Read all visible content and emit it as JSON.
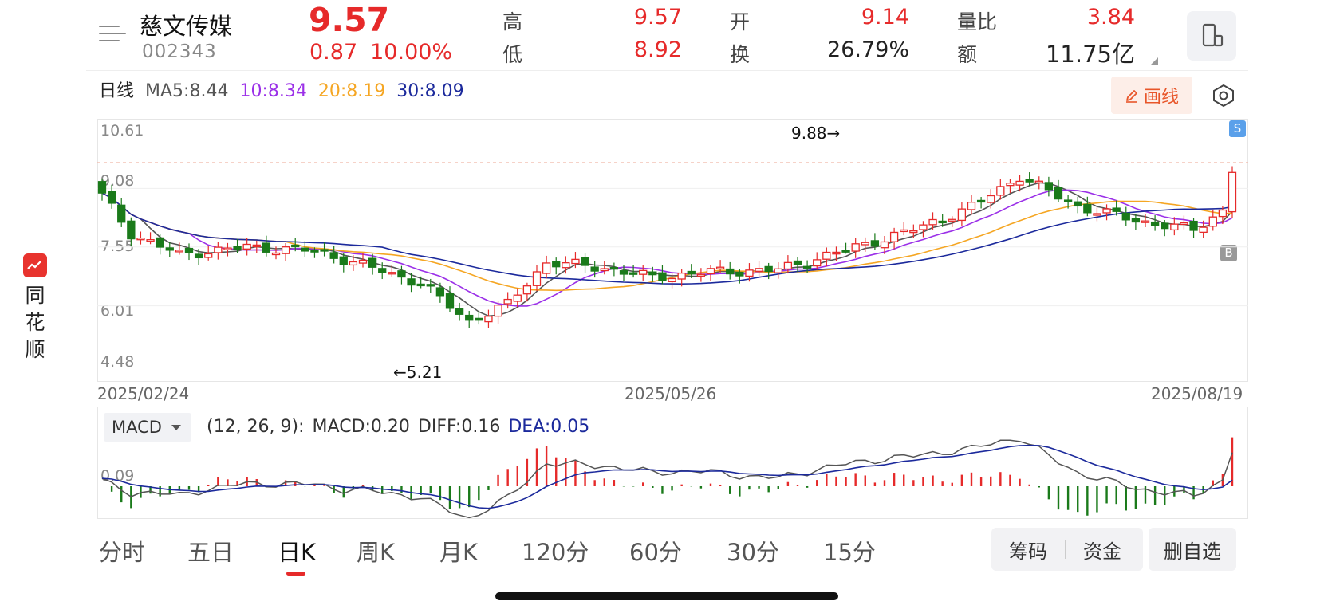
{
  "header": {
    "stock_name": "慈文传媒",
    "stock_code": "002343",
    "price": "9.57",
    "change": "0.87",
    "change_pct": "10.00%",
    "quotes": {
      "high_label": "高",
      "high": "9.57",
      "low_label": "低",
      "low": "8.92",
      "open_label": "开",
      "open": "9.14",
      "turnover_label": "换",
      "turnover": "26.79%",
      "vol_ratio_label": "量比",
      "vol_ratio": "3.84",
      "amount_label": "额",
      "amount": "11.75亿"
    }
  },
  "ma_legend": {
    "period": "日线",
    "ma5": "MA5:8.44",
    "ma10": "10:8.34",
    "ma20": "20:8.19",
    "ma30": "30:8.09"
  },
  "toolbar": {
    "draw_label": "画线"
  },
  "side_logo": {
    "text": "同花顺"
  },
  "kchart": {
    "y_ticks": [
      "10.61",
      "9.08",
      "7.55",
      "6.01",
      "4.48"
    ],
    "dates": [
      "2025/02/24",
      "2025/05/26",
      "2025/08/19"
    ],
    "high_anno": "9.88→",
    "low_anno": "←5.21",
    "sell_mark": "S",
    "buy_mark": "B"
  },
  "macd": {
    "selector": "MACD",
    "params": "(12, 26, 9):",
    "macd": "MACD:0.20",
    "diff": "DIFF:0.16",
    "dea": "DEA:0.05",
    "zero_label": "0.09"
  },
  "tabs": [
    "分时",
    "五日",
    "日K",
    "周K",
    "月K",
    "120分",
    "60分",
    "30分",
    "15分"
  ],
  "active_tab": "日K",
  "buttons": {
    "chips": "筹码",
    "funds": "资金",
    "remove_watch": "删自选"
  },
  "colors": {
    "up": "#e62a2a",
    "down": "#1a7a1a",
    "ma5": "#555555",
    "ma10": "#9b30e8",
    "ma20": "#f5a623",
    "ma30": "#1c2a9c",
    "dea": "#1c2a9c"
  }
}
